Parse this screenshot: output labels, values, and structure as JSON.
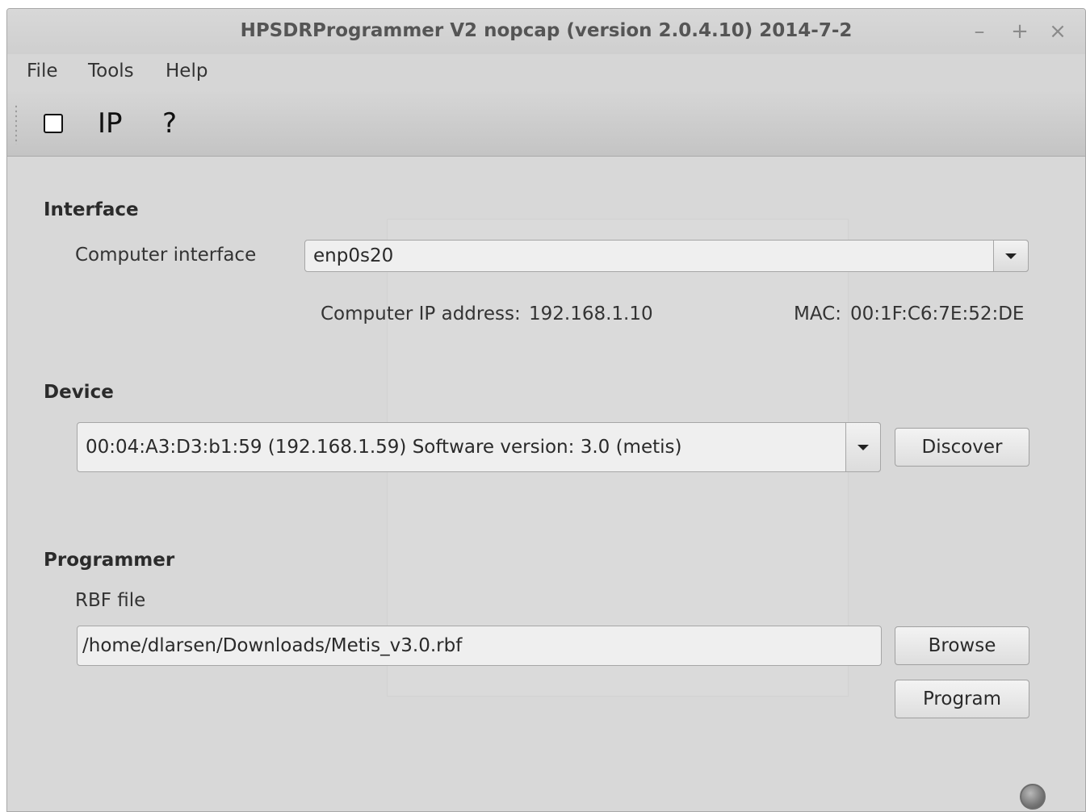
{
  "window": {
    "title": "HPSDRProgrammer V2 nopcap (version 2.0.4.10) 2014-7-2",
    "controls": {
      "minimize": "–",
      "maximize": "+",
      "close": "×"
    }
  },
  "menubar": {
    "items": [
      {
        "label": "File"
      },
      {
        "label": "Tools"
      },
      {
        "label": "Help"
      }
    ]
  },
  "toolbar": {
    "checkbox_icon": "checkbox-icon",
    "ip_label": "IP",
    "help_label": "?"
  },
  "interface": {
    "section_label": "Interface",
    "computer_interface_label": "Computer interface",
    "computer_interface_value": "enp0s20",
    "ip_label": "Computer IP address:",
    "ip_value": "192.168.1.10",
    "mac_label": "MAC:",
    "mac_value": "00:1F:C6:7E:52:DE"
  },
  "device": {
    "section_label": "Device",
    "selected": "00:04:A3:D3:b1:59 (192.168.1.59) Software version: 3.0 (metis)",
    "discover_label": "Discover"
  },
  "programmer": {
    "section_label": "Programmer",
    "rbf_label": "RBF file",
    "rbf_path": "/home/dlarsen/Downloads/Metis_v3.0.rbf",
    "browse_label": "Browse",
    "program_label": "Program"
  },
  "status": {
    "led_color": "#777777"
  }
}
